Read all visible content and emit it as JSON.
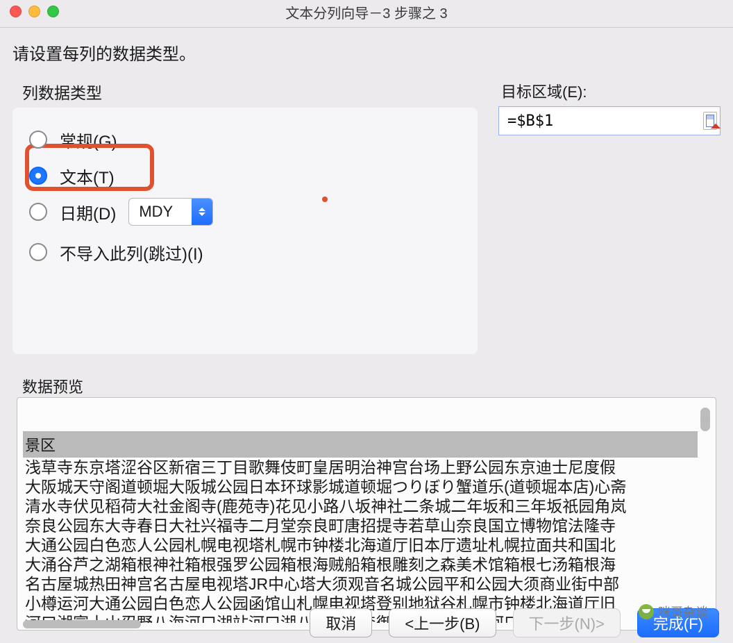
{
  "window": {
    "title": "文本分列向导－3 步骤之 3"
  },
  "instruction": "请设置每列的数据类型。",
  "column_type": {
    "group_label": "列数据类型",
    "general": "常规(G)",
    "text": "文本(T)",
    "date": "日期(D)",
    "date_format": "MDY",
    "skip": "不导入此列(跳过)(I)",
    "selected": "text"
  },
  "target": {
    "label": "目标区域(E):",
    "value": "=$B$1"
  },
  "preview": {
    "label": "数据预览",
    "header": "景区",
    "rows": [
      "浅草寺东京塔涩谷区新宿三丁目歌舞伎町皇居明治神宫台场上野公园东京迪士尼度假",
      "大阪城天守阁道顿堀大阪城公园日本环球影城道顿堀つりぼり蟹道乐(道顿堀本店)心斋",
      "清水寺伏见稻荷大社金阁寺(鹿苑寺)花见小路八坂神社二条城二年坂和三年坂祇园角岚",
      "奈良公园东大寺春日大社兴福寺二月堂奈良町唐招提寺若草山奈良国立博物馆法隆寺",
      "大通公园白色恋人公园札幌电视塔札幌市钟楼北海道厅旧本厅遗址札幌拉面共和国北",
      "大涌谷芦之湖箱根神社箱根强罗公园箱根海贼船箱根雕刻之森美术馆箱根七汤箱根海",
      "名古屋城热田神宫名古屋电视塔JR中心塔大须观音名城公园平和公园大须商业街中部",
      "小樽运河大通公园白色恋人公园函馆山札幌电视塔登别地狱谷札幌市钟楼北海道厅旧",
      "河口湖富士山忍野八海河口湖站河口湖八音盒之森御殿场奥特莱斯河口湖自然生活馆"
    ]
  },
  "footer": {
    "cancel": "取消",
    "back": "<上一步(B)",
    "next": "下一步(N)>",
    "finish": "完成(F)"
  },
  "watermark": "咪哥杂谈"
}
